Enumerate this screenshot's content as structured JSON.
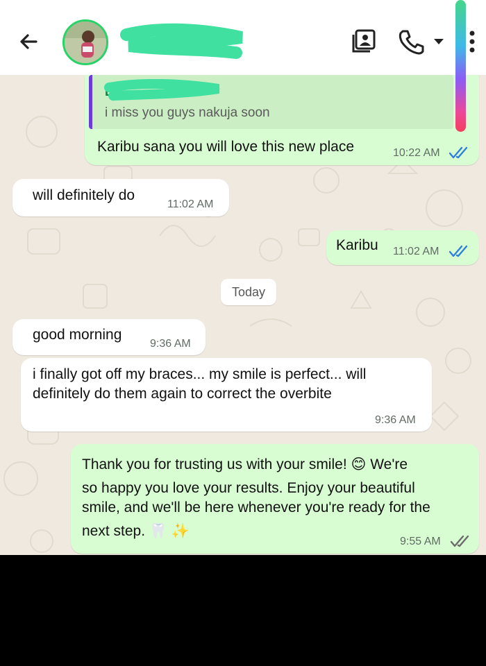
{
  "header": {
    "contact_name": "",
    "icons": [
      "back-arrow-icon",
      "avatar",
      "contact-card-icon",
      "phone-icon",
      "dropdown-icon",
      "more-options-icon"
    ]
  },
  "quoted": {
    "name": "Ly...",
    "text": "i miss you guys nakuja soon"
  },
  "messages": [
    {
      "dir": "out",
      "text": "Karibu sana you will love this new place",
      "time": "10:22 AM",
      "read": true
    },
    {
      "dir": "in",
      "text": "will definitely do",
      "time": "11:02 AM"
    },
    {
      "dir": "out",
      "text": "Karibu",
      "time": "11:02 AM",
      "read": true
    },
    {
      "dir": "in",
      "text": "good morning",
      "time": "9:36 AM"
    },
    {
      "dir": "in",
      "lines": [
        "i finally got off my braces... my smile is perfect... will",
        "definitely do them again to correct the overbite"
      ],
      "time": "9:36 AM"
    },
    {
      "dir": "out",
      "lines": [
        "Thank you for trusting us with your smile! 😊 We're",
        "so happy you love your results. Enjoy your beautiful",
        "smile, and we'll be here whenever you're ready for the",
        "next step. 🦷 ✨"
      ],
      "time": "9:55 AM",
      "read": true
    }
  ],
  "day_divider": "Today",
  "colors": {
    "outgoing": "#d8fdd2",
    "incoming": "#ffffff",
    "read_ticks": "#2f7fdc",
    "unread_ticks": "#6b6b6b",
    "avatar_ring": "#25d366"
  }
}
